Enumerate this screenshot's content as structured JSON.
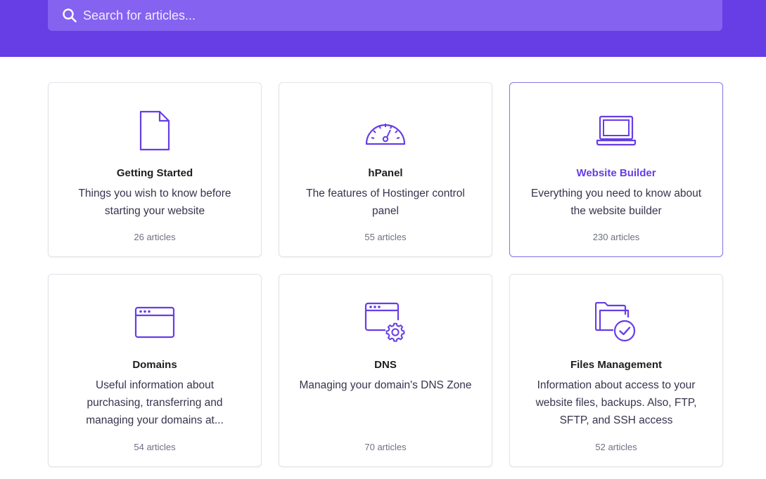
{
  "search": {
    "placeholder": "Search for articles..."
  },
  "colors": {
    "brand": "#673de6",
    "search_bg": "#8562f0",
    "icon": "#673de6",
    "active_title": "#673de6"
  },
  "categories": [
    {
      "icon": "document-icon",
      "title": "Getting Started",
      "description": "Things you wish to know before starting your website",
      "count": "26 articles"
    },
    {
      "icon": "speedometer-icon",
      "title": "hPanel",
      "description": "The features of Hostinger control panel",
      "count": "55 articles"
    },
    {
      "icon": "laptop-icon",
      "title": "Website Builder",
      "description": "Everything you need to know about the website builder",
      "count": "230 articles",
      "highlighted": true
    },
    {
      "icon": "browser-window-icon",
      "title": "Domains",
      "description": "Useful information about purchasing, transferring and managing your domains at...",
      "count": "54 articles"
    },
    {
      "icon": "browser-settings-icon",
      "title": "DNS",
      "description": "Managing your domain's DNS Zone",
      "count": "70 articles"
    },
    {
      "icon": "folder-check-icon",
      "title": "Files Management",
      "description": "Information about access to your website files, backups. Also, FTP, SFTP, and SSH access",
      "count": "52 articles"
    }
  ]
}
